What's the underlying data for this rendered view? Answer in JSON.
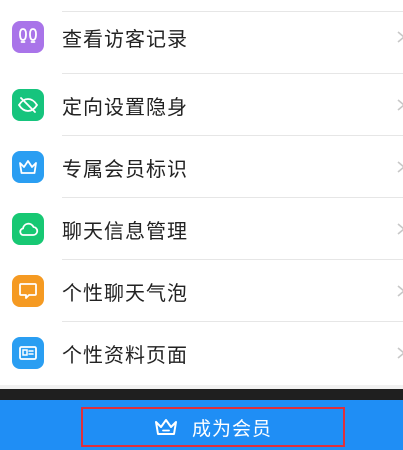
{
  "menu": {
    "items": [
      {
        "label": "查看访客记录",
        "icon": "footprints-icon",
        "color": "#a974e9"
      },
      {
        "label": "定向设置隐身",
        "icon": "eye-off-icon",
        "color": "#16c47d"
      },
      {
        "label": "专属会员标识",
        "icon": "crown-icon",
        "color": "#2a9ef2"
      },
      {
        "label": "聊天信息管理",
        "icon": "cloud-icon",
        "color": "#17c873"
      },
      {
        "label": "个性聊天气泡",
        "icon": "chat-bubble-icon",
        "color": "#f59a22"
      },
      {
        "label": "个性资料页面",
        "icon": "id-card-icon",
        "color": "#2a9ef2"
      }
    ]
  },
  "cta": {
    "label": "成为会员",
    "icon": "crown-icon",
    "bar_color": "#1f8ef5",
    "highlight_color": "#e0303a"
  }
}
